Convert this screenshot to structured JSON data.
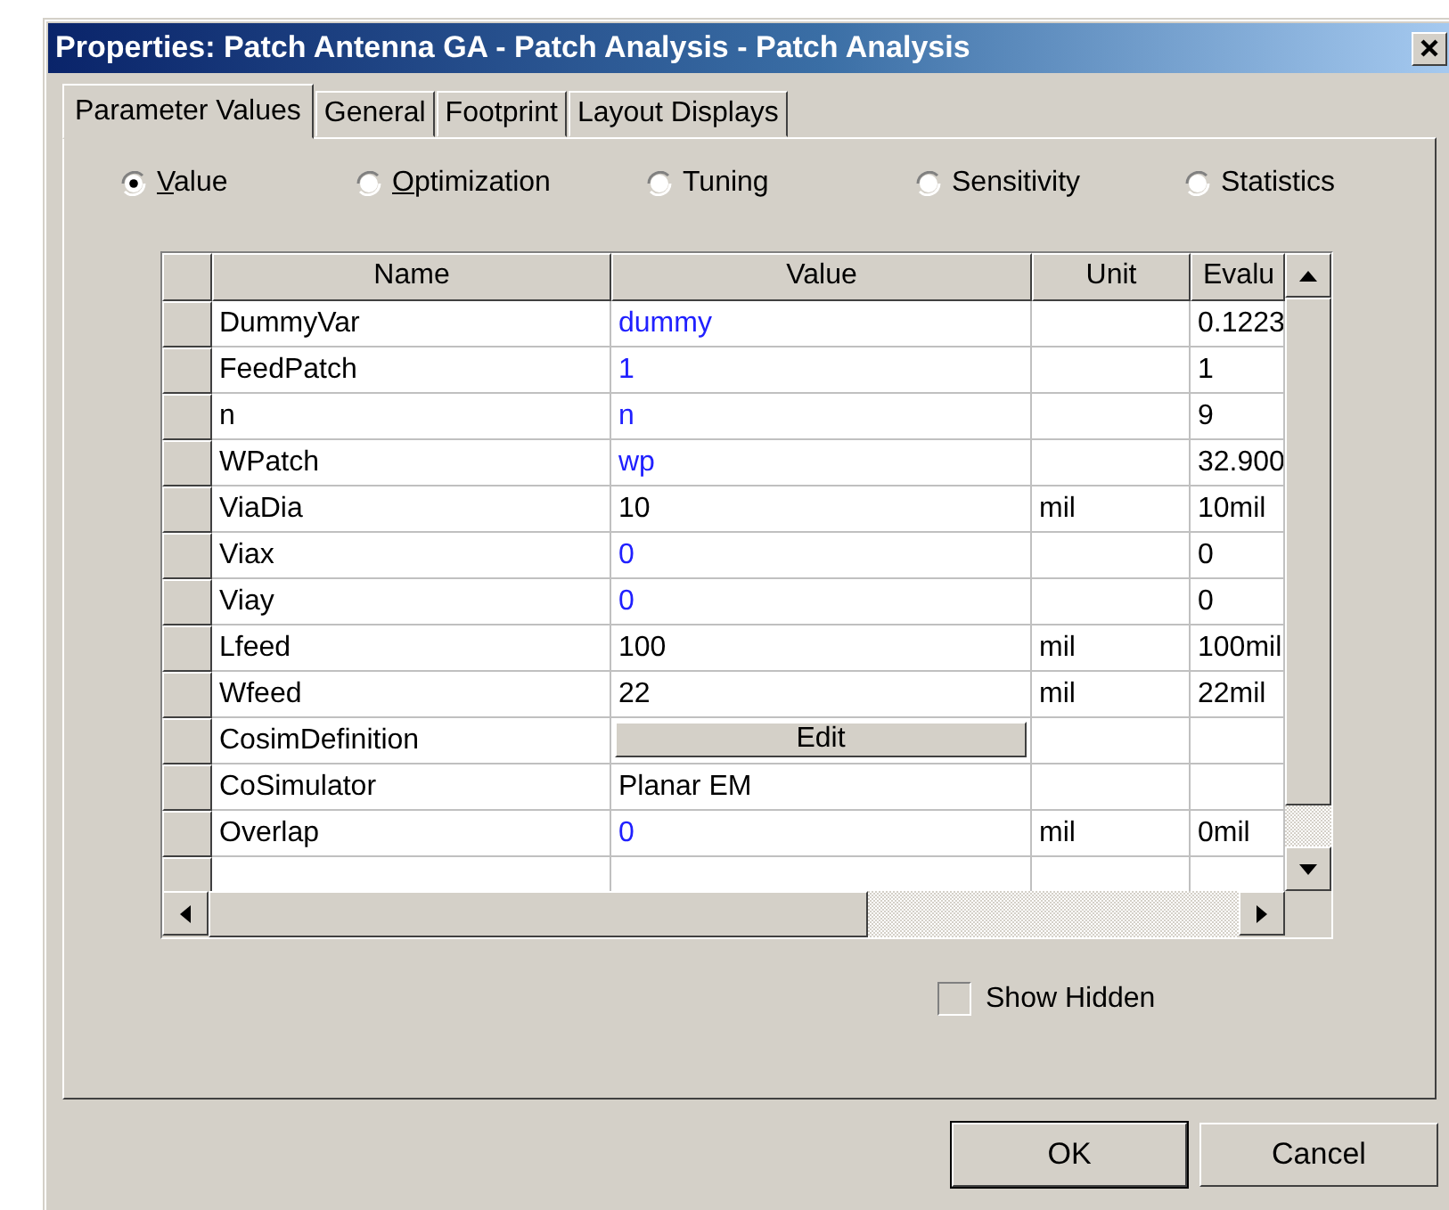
{
  "window": {
    "title": "Properties: Patch Antenna GA - Patch Analysis - Patch Analysis"
  },
  "tabs": [
    {
      "label": "Parameter Values",
      "selected": true
    },
    {
      "label": "General",
      "selected": false
    },
    {
      "label": "Footprint",
      "selected": false
    },
    {
      "label": "Layout Displays",
      "selected": false
    }
  ],
  "modes": [
    {
      "label": "Value",
      "selected": true,
      "underlined_first_letter": true
    },
    {
      "label": "Optimization",
      "selected": false,
      "underlined_first_letter": true
    },
    {
      "label": "Tuning",
      "selected": false,
      "underlined_first_letter": false
    },
    {
      "label": "Sensitivity",
      "selected": false,
      "underlined_first_letter": false
    },
    {
      "label": "Statistics",
      "selected": false,
      "underlined_first_letter": false
    }
  ],
  "table": {
    "columns": [
      "Name",
      "Value",
      "Unit",
      "Evalu"
    ],
    "rows": [
      {
        "kind": "text",
        "name": "DummyVar",
        "value": {
          "text": "dummy",
          "color": "#2020ff"
        },
        "unit": "",
        "evaluated": "0.1223"
      },
      {
        "kind": "text",
        "name": "FeedPatch",
        "value": {
          "text": "1",
          "color": "#2020ff"
        },
        "unit": "",
        "evaluated": "1"
      },
      {
        "kind": "text",
        "name": "n",
        "value": {
          "text": "n",
          "color": "#2020ff"
        },
        "unit": "",
        "evaluated": "9"
      },
      {
        "kind": "text",
        "name": "WPatch",
        "value": {
          "text": "wp",
          "color": "#2020ff"
        },
        "unit": "",
        "evaluated": "32.900"
      },
      {
        "kind": "text",
        "name": "ViaDia",
        "value": {
          "text": "10",
          "color": "#000000"
        },
        "unit": "mil",
        "evaluated": "10mil"
      },
      {
        "kind": "text",
        "name": "Viax",
        "value": {
          "text": "0",
          "color": "#2020ff"
        },
        "unit": "",
        "evaluated": "0"
      },
      {
        "kind": "text",
        "name": "Viay",
        "value": {
          "text": "0",
          "color": "#2020ff"
        },
        "unit": "",
        "evaluated": "0"
      },
      {
        "kind": "text",
        "name": "Lfeed",
        "value": {
          "text": "100",
          "color": "#000000"
        },
        "unit": "mil",
        "evaluated": "100mil"
      },
      {
        "kind": "text",
        "name": "Wfeed",
        "value": {
          "text": "22",
          "color": "#000000"
        },
        "unit": "mil",
        "evaluated": "22mil"
      },
      {
        "kind": "button",
        "name": "CosimDefinition",
        "value": {
          "text": "Edit"
        },
        "unit": "",
        "evaluated": ""
      },
      {
        "kind": "text",
        "name": "CoSimulator",
        "value": {
          "text": "Planar EM",
          "color": "#000000"
        },
        "unit": "",
        "evaluated": ""
      },
      {
        "kind": "text",
        "name": "Overlap",
        "value": {
          "text": "0",
          "color": "#2020ff"
        },
        "unit": "mil",
        "evaluated": "0mil"
      }
    ]
  },
  "show_hidden": {
    "label": "Show Hidden",
    "checked": false
  },
  "buttons": [
    {
      "label": "OK",
      "default": true
    },
    {
      "label": "Cancel",
      "default": false
    }
  ]
}
